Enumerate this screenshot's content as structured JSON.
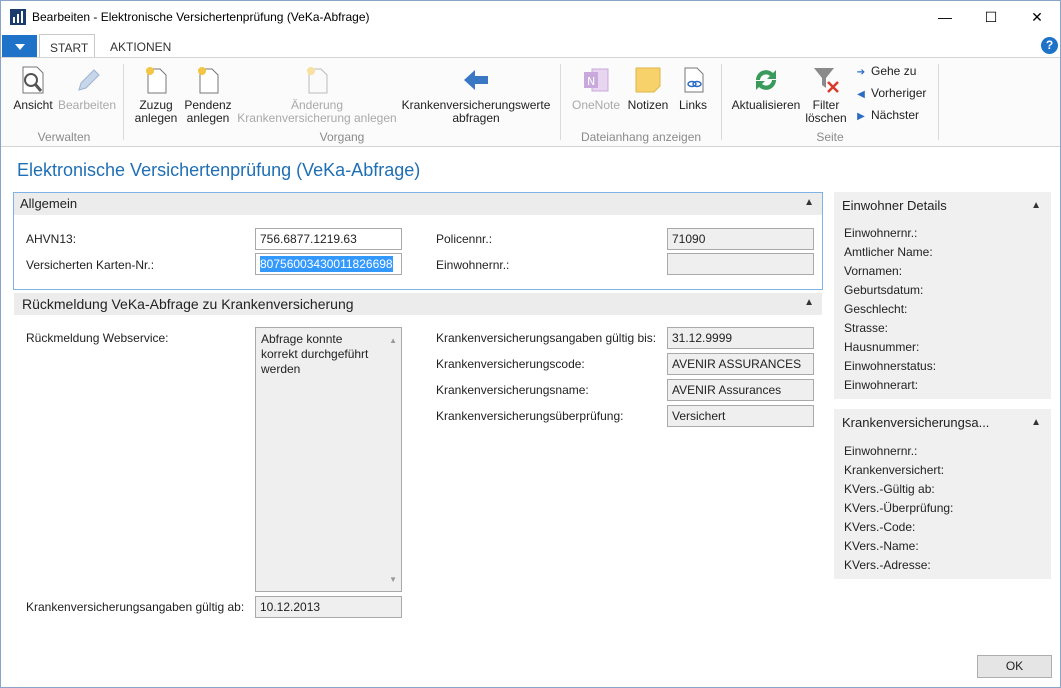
{
  "window": {
    "title": "Bearbeiten - Elektronische Versichertenprüfung (VeKa-Abfrage)",
    "minimize": "—",
    "maximize": "☐",
    "close": "✕"
  },
  "ribbon_tabs": [
    "START",
    "AKTIONEN"
  ],
  "help": "?",
  "ribbon": {
    "verwalten": {
      "label": "Verwalten",
      "ansicht": "Ansicht",
      "bearbeiten": "Bearbeiten"
    },
    "vorgang": {
      "label": "Vorgang",
      "zuzug_1": "Zuzug",
      "zuzug_2": "anlegen",
      "pendenz_1": "Pendenz",
      "pendenz_2": "anlegen",
      "aenderung_1": "Änderung",
      "aenderung_2": "Krankenversicherung anlegen",
      "kvw_1": "Krankenversicherungswerte",
      "kvw_2": "abfragen"
    },
    "dateianhang": {
      "label": "Dateianhang anzeigen",
      "onenote": "OneNote",
      "notizen": "Notizen",
      "links": "Links"
    },
    "seite": {
      "label": "Seite",
      "aktualisieren": "Aktualisieren",
      "filter_1": "Filter",
      "filter_2": "löschen",
      "gehe_zu": "Gehe zu",
      "vorheriger": "Vorheriger",
      "naechster": "Nächster"
    }
  },
  "page_title": "Elektronische Versichertenprüfung (VeKa-Abfrage)",
  "allgemein": {
    "header": "Allgemein",
    "ahvn13_label": "AHVN13:",
    "ahvn13_value": "756.6877.1219.63",
    "karten_label": "Versicherten Karten-Nr.:",
    "karten_value": "80756003430011826698",
    "policennr_label": "Policennr.:",
    "policennr_value": "71090",
    "einwohnernr_label": "Einwohnernr.:",
    "einwohnernr_value": ""
  },
  "rueckmeldung": {
    "header": "Rückmeldung VeKa-Abfrage zu Krankenversicherung",
    "webservice_label": "Rückmeldung Webservice:",
    "webservice_value": "Abfrage konnte korrekt durchgeführt werden",
    "gueltig_ab_label": "Krankenversicherungsangaben gültig ab:",
    "gueltig_ab_value": "10.12.2013",
    "gueltig_bis_label": "Krankenversicherungsangaben gültig bis:",
    "gueltig_bis_value": "31.12.9999",
    "code_label": "Krankenversicherungscode:",
    "code_value": "AVENIR ASSURANCES",
    "name_label": "Krankenversicherungsname:",
    "name_value": "AVENIR Assurances",
    "pruefung_label": "Krankenversicherungsüberprüfung:",
    "pruefung_value": "Versichert"
  },
  "einwohner_details": {
    "title": "Einwohner Details",
    "items": [
      "Einwohnernr.:",
      "Amtlicher Name:",
      "Vornamen:",
      "Geburtsdatum:",
      "Geschlecht:",
      "Strasse:",
      "Hausnummer:",
      "Einwohnerstatus:",
      "Einwohnerart:"
    ]
  },
  "krankenversicherung_box": {
    "title": "Krankenversicherungsa...",
    "items": [
      "Einwohnernr.:",
      "Krankenversichert:",
      "KVers.-Gültig ab:",
      "KVers.-Überprüfung:",
      "KVers.-Code:",
      "KVers.-Name:",
      "KVers.-Adresse:"
    ]
  },
  "ok_button": "OK",
  "colors": {
    "accent": "#1e73c8",
    "title_blue": "#1f6fb5",
    "section_border": "#7fb3e6",
    "selection": "#3399ff"
  }
}
